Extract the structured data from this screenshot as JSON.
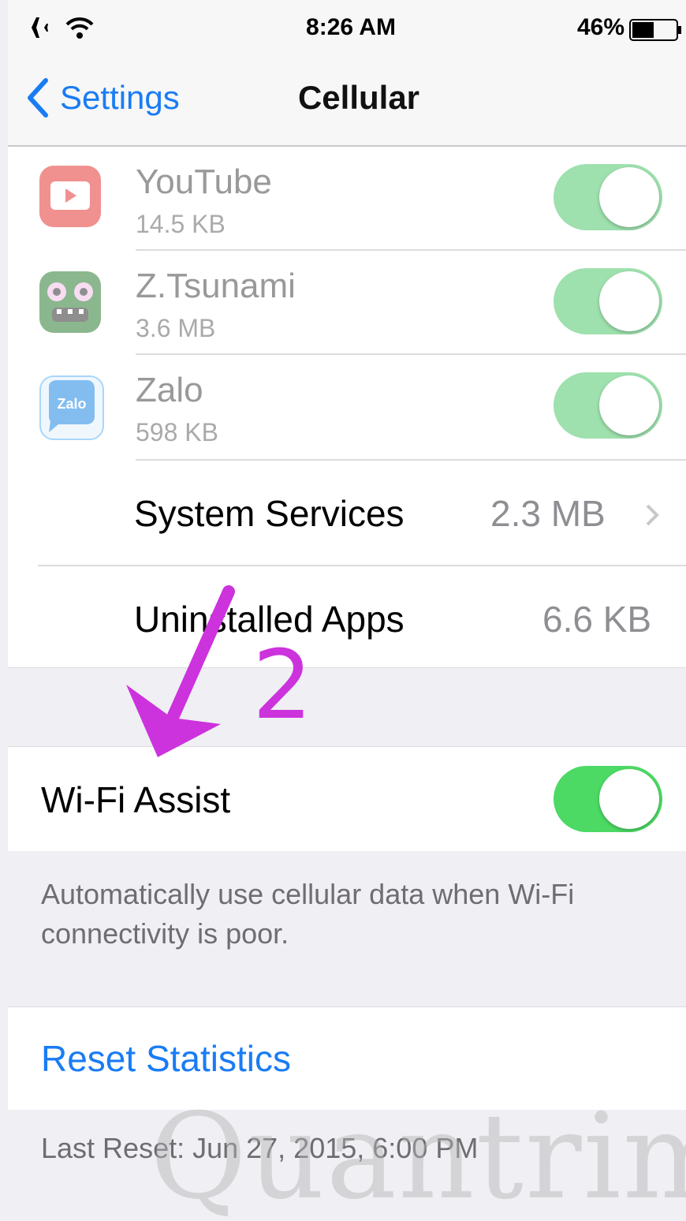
{
  "status_bar": {
    "time": "8:26 AM",
    "battery": "46%"
  },
  "nav": {
    "back_label": "Settings",
    "title": "Cellular"
  },
  "apps": [
    {
      "name": "YouTube",
      "size": "14.5 KB",
      "enabled": true
    },
    {
      "name": "Z.Tsunami",
      "size": "3.6 MB",
      "enabled": true
    },
    {
      "name": "Zalo",
      "size": "598 KB",
      "enabled": true,
      "icon_text": "Zalo"
    }
  ],
  "system_services": {
    "label": "System Services",
    "value": "2.3 MB"
  },
  "uninstalled_apps": {
    "label": "Uninstalled Apps",
    "value": "6.6 KB"
  },
  "annotation": {
    "number": "2"
  },
  "wifi_assist": {
    "label": "Wi-Fi Assist",
    "enabled": true,
    "description": "Automatically use cellular data when Wi-Fi connectivity is poor."
  },
  "reset": {
    "label": "Reset Statistics",
    "last_reset": "Last Reset: Jun 27, 2015, 6:00 PM"
  },
  "watermark": "Quantrimang",
  "colors": {
    "accent": "#1a7cf4",
    "toggle_on": "#4cd964",
    "annotation": "#cc33dd"
  }
}
